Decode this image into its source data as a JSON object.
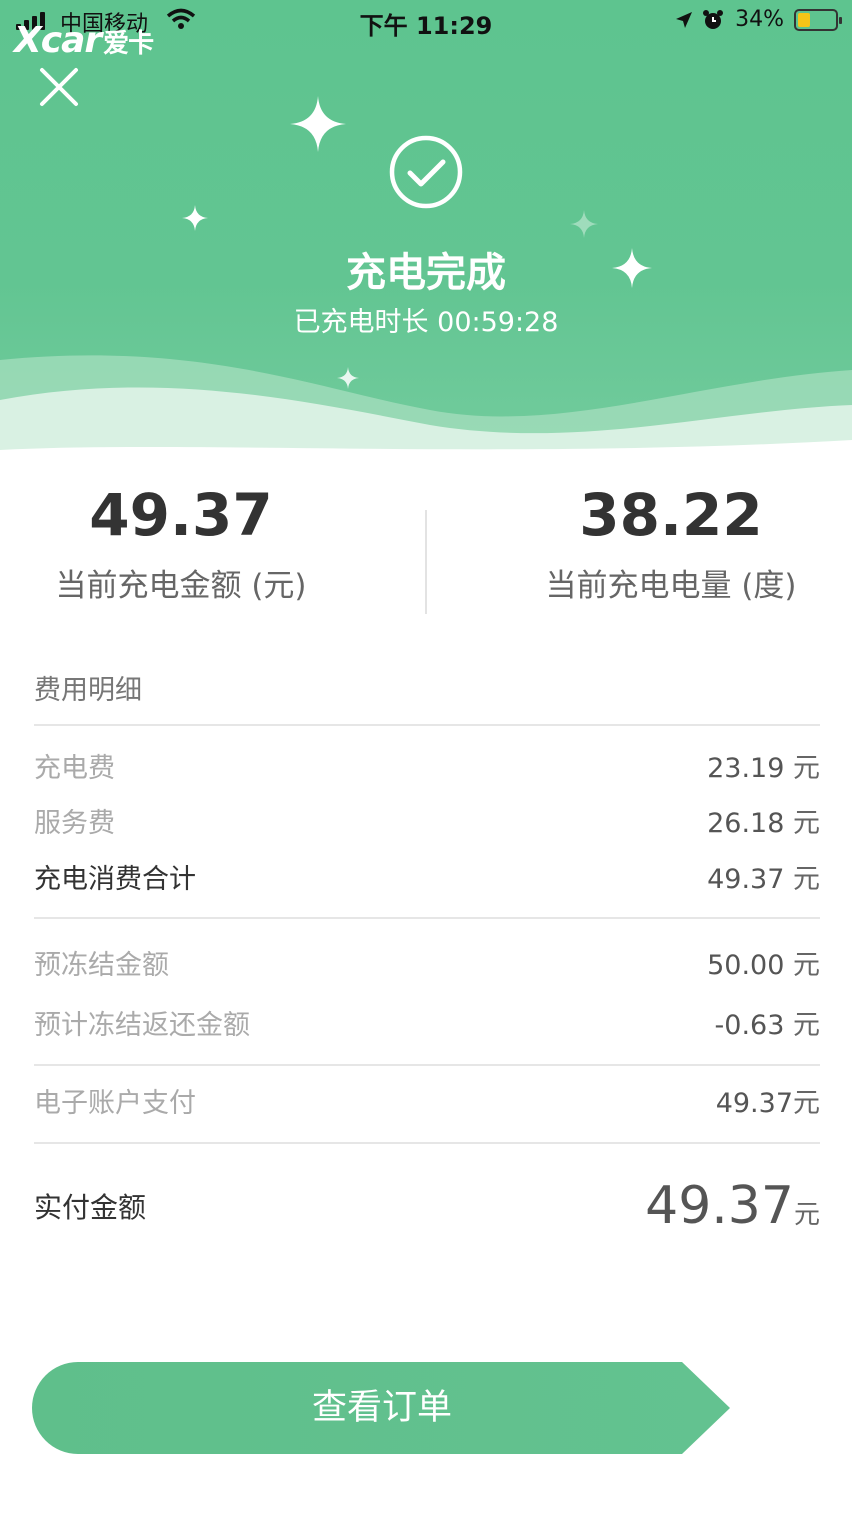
{
  "status_bar": {
    "carrier": "中国移动",
    "time": "下午 11:29",
    "battery": "34%"
  },
  "watermark": {
    "brand": "Xcar",
    "cn": "爱卡"
  },
  "header": {
    "title": "充电完成",
    "duration": "已充电时长 00:59:28"
  },
  "summary": {
    "amount_value": "49.37",
    "amount_label": "当前充电金额 (元)",
    "energy_value": "38.22",
    "energy_label": "当前充电电量 (度)"
  },
  "details": {
    "title": "费用明细",
    "unit": "元",
    "charge_fee": {
      "label": "充电费",
      "value": "23.19"
    },
    "service_fee": {
      "label": "服务费",
      "value": "26.18"
    },
    "subtotal": {
      "label": "充电消费合计",
      "value": "49.37"
    },
    "frozen": {
      "label": "预冻结金额",
      "value": "50.00"
    },
    "refund": {
      "label": "预计冻结返还金额",
      "value": "-0.63"
    },
    "wallet": {
      "label": "电子账户支付",
      "value": "49.37"
    },
    "paid": {
      "label": "实付金额",
      "value": "49.37"
    }
  },
  "view_order_button": "查看订单",
  "colors": {
    "brand_green": "#5ec48f",
    "button_green": "#5fbf8b"
  }
}
